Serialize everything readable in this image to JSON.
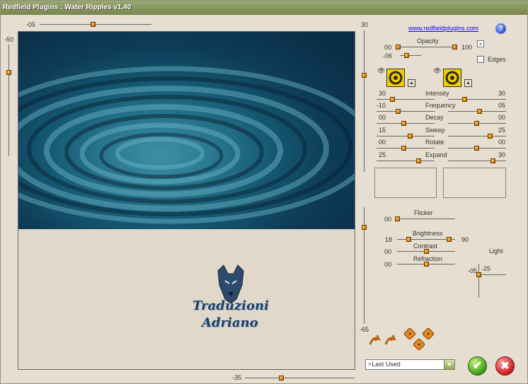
{
  "window": {
    "title": "Redfield Plugins : Water Ripples v1.40"
  },
  "preview": {
    "top_slider": {
      "label": "-05",
      "value": -5
    },
    "left_slider": {
      "label": "-50",
      "value": -50
    },
    "bottom_slider": {
      "label": "-35",
      "value": -35
    },
    "right_slider_top": {
      "label": "30",
      "value": 30
    },
    "right_slider_bottom": {
      "label": "-65",
      "value": -65
    },
    "watermark_line1": "Traduzioni",
    "watermark_line2": "Adriano"
  },
  "header": {
    "website": "www.redfieldplugins.com",
    "help": "?"
  },
  "opacity": {
    "label": "Opacity",
    "min": "00",
    "max": "100",
    "sub_value": "-06",
    "value": 100
  },
  "edges": {
    "label": "Edges",
    "checked": false
  },
  "color1": {
    "hex": "#f3cd00"
  },
  "color2": {
    "hex": "#f3cd00"
  },
  "ripple_params": [
    {
      "name": "Intensity",
      "left": "30",
      "right": "30"
    },
    {
      "name": "Frequency",
      "left": "-10",
      "right": "05"
    },
    {
      "name": "Decay",
      "left": "00",
      "right": "00"
    },
    {
      "name": "Sweep",
      "left": "15",
      "right": "25"
    },
    {
      "name": "Rotate",
      "left": "00",
      "right": "00"
    },
    {
      "name": "Expand",
      "left": "25",
      "right": "30"
    }
  ],
  "lighting": {
    "flicker": {
      "label": "Flicker",
      "value": "00"
    },
    "brightness": {
      "label": "Brightness",
      "left": "18",
      "right": "90"
    },
    "contrast": {
      "label": "Contrast",
      "value": "00"
    },
    "refraction": {
      "label": "Refraction",
      "value": "00"
    },
    "light": {
      "label": "Light",
      "x": "-05",
      "y": "-25"
    }
  },
  "preset": {
    "selected": ">Last Used"
  },
  "colors": {
    "accent": "#e0830c",
    "water": "#0e3c58",
    "background": "#e6ded0"
  }
}
